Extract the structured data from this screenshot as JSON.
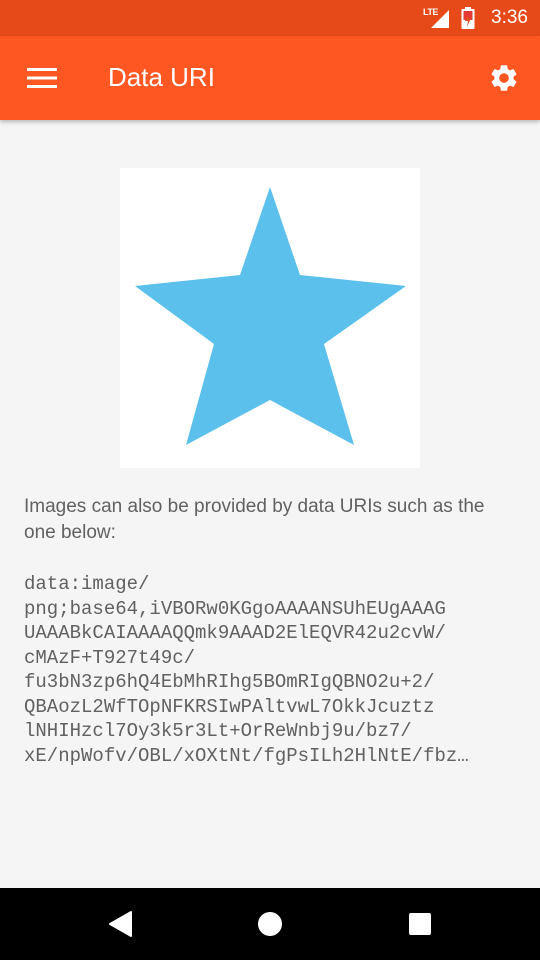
{
  "status_bar": {
    "network_label": "LTE",
    "time": "3:36",
    "icons": [
      "signal-icon",
      "battery-icon"
    ]
  },
  "app_bar": {
    "title": "Data URI",
    "menu_icon": "hamburger-menu-icon",
    "settings_icon": "gear-icon",
    "background_color": "#ff5722",
    "status_color": "#e64a19"
  },
  "content": {
    "image": {
      "icon": "star-icon",
      "color": "#5bc0eb"
    },
    "description": "Images can also be provided by data URIs such as the one below:",
    "data_uri_lines": [
      "data:image/",
      "png;base64,iVBORw0KGgoAAAANSUhEUgAAAG",
      "UAAABkCAIAAAAQQmk9AAAD2ElEQVR42u2cvW/",
      "cMAzF+T927t49c/",
      "fu3bN3zp6hQ4EbMhRIhg5BOmRIgQBNO2u+2/",
      "QBAozL2WfTOpNFKRSIwPAltvwL7OkkJcuztz",
      "lNHIHzcl7Oy3k5r3Lt+OrReWnbj9u/bz7/",
      "xE/npWofv/OBL/xOXtNt/fgPsILh2HlNtE/fbz…"
    ]
  },
  "nav_bar": {
    "back_icon": "back-triangle-icon",
    "home_icon": "home-circle-icon",
    "recents_icon": "recents-square-icon"
  }
}
